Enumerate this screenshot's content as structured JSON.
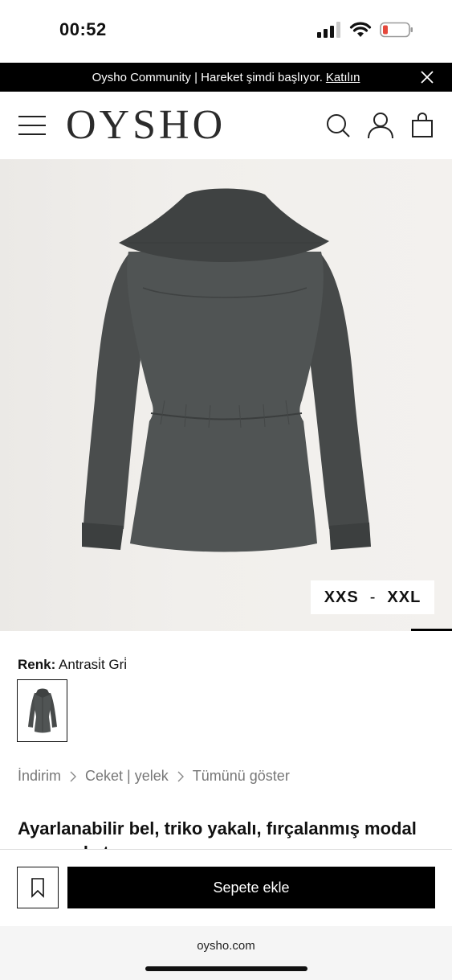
{
  "status_bar": {
    "time": "00:52",
    "icons": [
      "signal-icon",
      "wifi-icon",
      "battery-icon"
    ],
    "battery_color": "#e5483c"
  },
  "promo": {
    "text": "Oysho Community | Hareket şimdi başlıyor.",
    "link": "Katılın"
  },
  "header": {
    "logo": "OYSHO",
    "icons": [
      "menu-icon",
      "search-icon",
      "user-icon",
      "bag-icon"
    ]
  },
  "product": {
    "size_from": "XXS",
    "size_sep": "-",
    "size_to": "XXL",
    "color_label": "Renk:",
    "color_value": "Antrasi̇t Gri̇",
    "garment_color": "#4a4d4d",
    "title": "Ayarlanabilir bel, triko yakalı, fırçalanmış modal uzun ceket"
  },
  "breadcrumb": [
    "İndirim",
    "Ceket | yelek",
    "Tümünü göster"
  ],
  "actions": {
    "add_to_cart": "Sepete ekle"
  },
  "browser": {
    "url": "oysho.com"
  }
}
